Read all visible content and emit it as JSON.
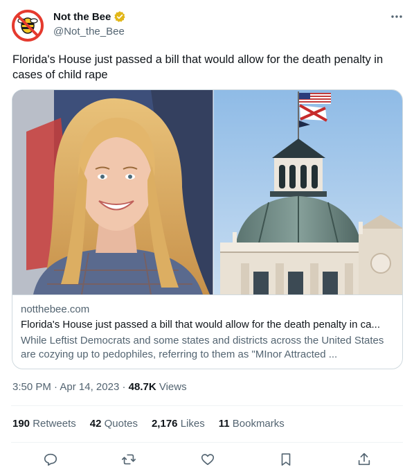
{
  "author": {
    "display_name": "Not the Bee",
    "handle": "@Not_the_Bee",
    "verified_badge": "gold-verified-badge",
    "avatar": "not-the-bee-logo"
  },
  "tweet": {
    "text": "Florida's House just passed a bill that would allow for the death penalty in cases of child rape"
  },
  "card": {
    "domain": "notthebee.com",
    "title": "Florida's House just passed a bill that would allow for the death penalty in ca...",
    "description": "While Leftist Democrats and some states and districts across the United States are cozying up to pedophiles, referring to them as \"MInor Attracted ...",
    "image_left": "portrait of smiling woman with long blonde hair",
    "image_right": "Florida capitol dome with American and Florida flags"
  },
  "meta": {
    "time": "3:50 PM",
    "separator": "·",
    "date": "Apr 14, 2023",
    "views_count": "48.7K",
    "views_label": "Views"
  },
  "stats": [
    {
      "count": "190",
      "label": "Retweets"
    },
    {
      "count": "42",
      "label": "Quotes"
    },
    {
      "count": "2,176",
      "label": "Likes"
    },
    {
      "count": "11",
      "label": "Bookmarks"
    }
  ],
  "actions": [
    "reply-icon",
    "retweet-icon",
    "like-icon",
    "bookmark-icon",
    "share-icon"
  ],
  "colors": {
    "text": "#0f1419",
    "secondary": "#536471",
    "border": "#cfd9de",
    "divider": "#eff3f4",
    "verified_gold": "#e2b719",
    "logo_red": "#e53a2e"
  }
}
